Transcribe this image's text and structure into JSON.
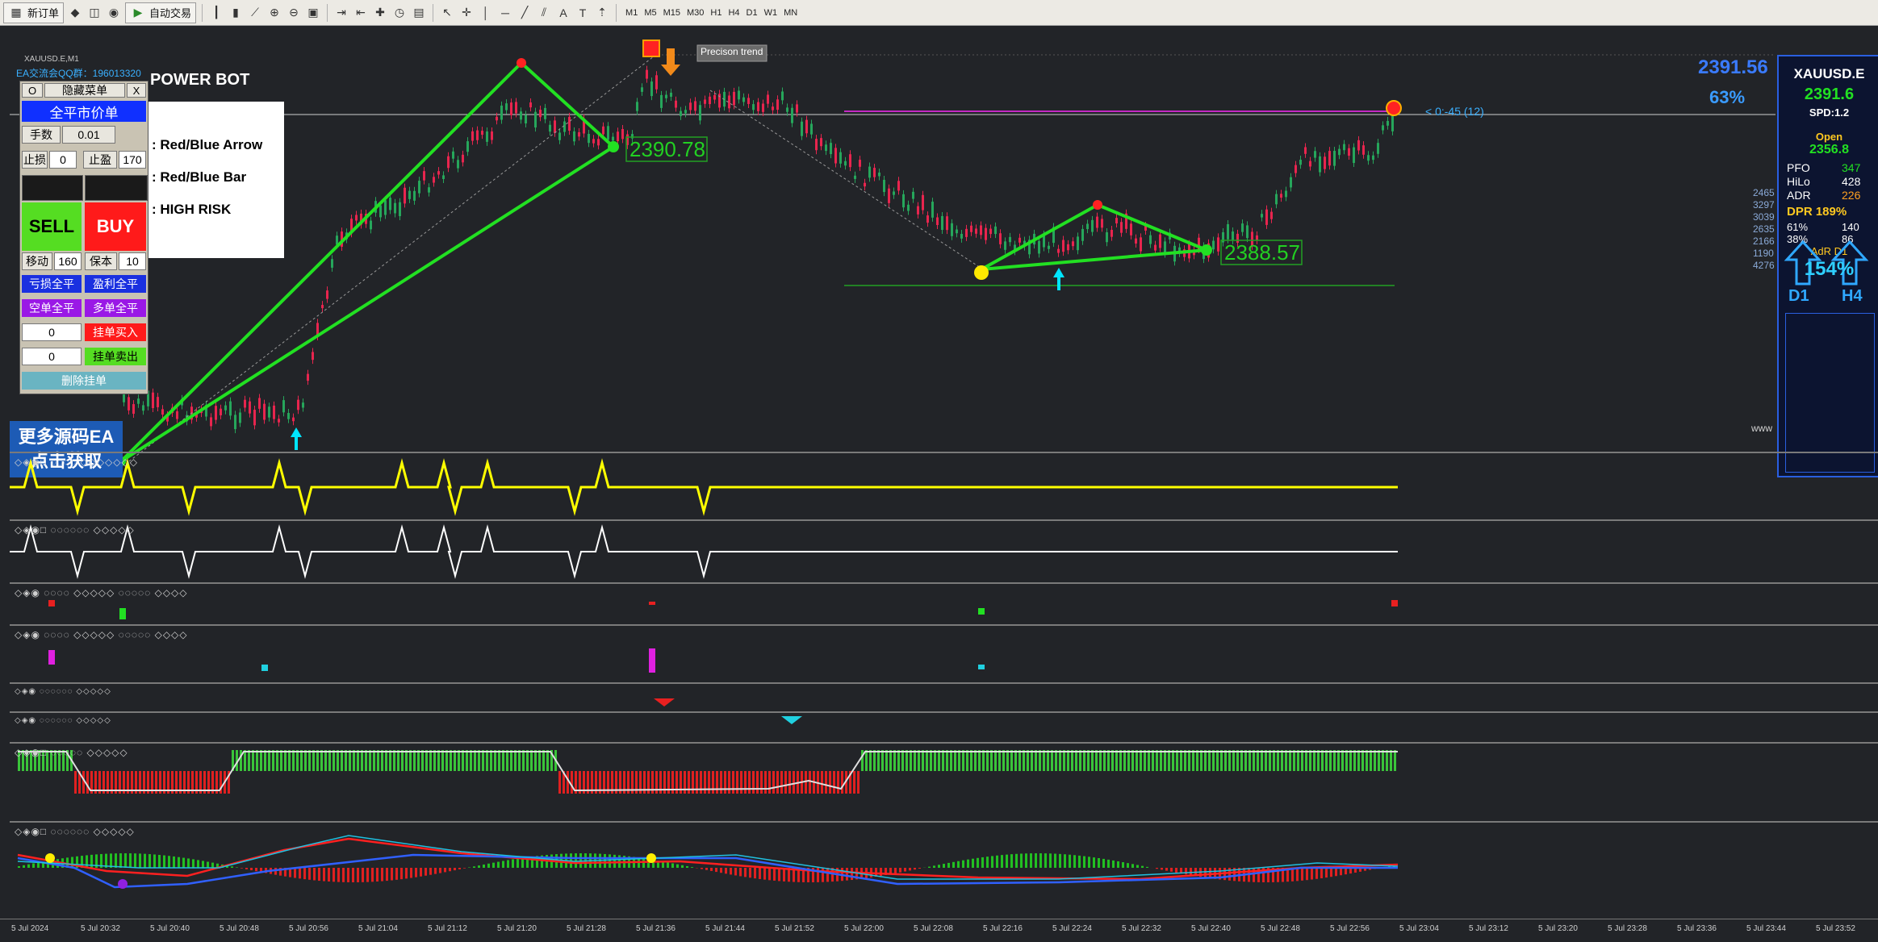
{
  "toolbar": {
    "new_order_label": "新订单",
    "auto_trade_label": "自动交易",
    "timeframes": [
      "M1",
      "M5",
      "M15",
      "M30",
      "H1",
      "H4",
      "D1",
      "W1",
      "MN"
    ]
  },
  "chart": {
    "symbol_label": "XAUUSD.E,M1",
    "qq_label": "EA交流会QQ群：196013320",
    "title": "POWER BOT",
    "legend": [
      ": Red/Blue Arrow",
      ": Red/Blue Bar",
      ": HIGH RISK"
    ],
    "precision_trend_label": "Precison trend",
    "price_label_1": "2390.78",
    "price_label_2": "2388.57",
    "countdown_label": "< 0:-45 (12)",
    "price_overlay": "2391.56",
    "percent_overlay": "63%",
    "www_label": "www",
    "right_numbers": [
      "2465",
      "3297",
      "3039",
      "2635",
      "2166",
      "1190",
      "4276"
    ],
    "colors": {
      "background": "#222428",
      "bull_candle": "#26a65b",
      "bear_candle": "#e8254e",
      "zigzag": "#22e022",
      "indicator_yellow": "#ffff00"
    }
  },
  "trade_panel": {
    "close_button": "X",
    "o_button": "O",
    "hide_menu": "隐藏菜单",
    "close_all_market": "全平市价单",
    "lot_label": "手数",
    "lot_value": "0.01",
    "sl_label": "止损",
    "sl_value": "0",
    "tp_label": "止盈",
    "tp_value": "170",
    "sell_label": "SELL",
    "buy_label": "BUY",
    "trail_label": "移动",
    "trail_value": "160",
    "breakeven_label": "保本",
    "breakeven_value": "10",
    "close_loss": "亏损全平",
    "close_profit": "盈利全平",
    "close_sell": "空单全平",
    "close_buy": "多单全平",
    "pending_buy_value": "0",
    "pending_buy_label": "挂单买入",
    "pending_sell_value": "0",
    "pending_sell_label": "挂单卖出",
    "delete_pending": "删除挂单"
  },
  "promo": {
    "line1": "更多源码EA",
    "line2": "点击获取"
  },
  "info_panel": {
    "symbol": "XAUUSD.E",
    "price": "2391.6",
    "spread": "SPD:1.2",
    "open_label": "Open",
    "open_value": "2356.8",
    "rows": [
      {
        "label": "PFO",
        "value": "347"
      },
      {
        "label": "HiLo",
        "value": "428"
      },
      {
        "label": "ADR",
        "value": "226"
      }
    ],
    "dpr_label": "DPR 189%",
    "stats": [
      {
        "label": "61%",
        "value": "140"
      },
      {
        "label": "38%",
        "value": "86"
      }
    ],
    "adr_d1_label": "AdR D1",
    "big_percent": "154%",
    "d1_label": "D1",
    "h4_label": "H4"
  },
  "time_axis": [
    "5 Jul 2024",
    "5 Jul 20:32",
    "5 Jul 20:40",
    "5 Jul 20:48",
    "5 Jul 20:56",
    "5 Jul 21:04",
    "5 Jul 21:12",
    "5 Jul 21:20",
    "5 Jul 21:28",
    "5 Jul 21:36",
    "5 Jul 21:44",
    "5 Jul 21:52",
    "5 Jul 22:00",
    "5 Jul 22:08",
    "5 Jul 22:16",
    "5 Jul 22:24",
    "5 Jul 22:32",
    "5 Jul 22:40",
    "5 Jul 22:48",
    "5 Jul 22:56",
    "5 Jul 23:04",
    "5 Jul 23:12",
    "5 Jul 23:20",
    "5 Jul 23:28",
    "5 Jul 23:36",
    "5 Jul 23:44",
    "5 Jul 23:52"
  ]
}
